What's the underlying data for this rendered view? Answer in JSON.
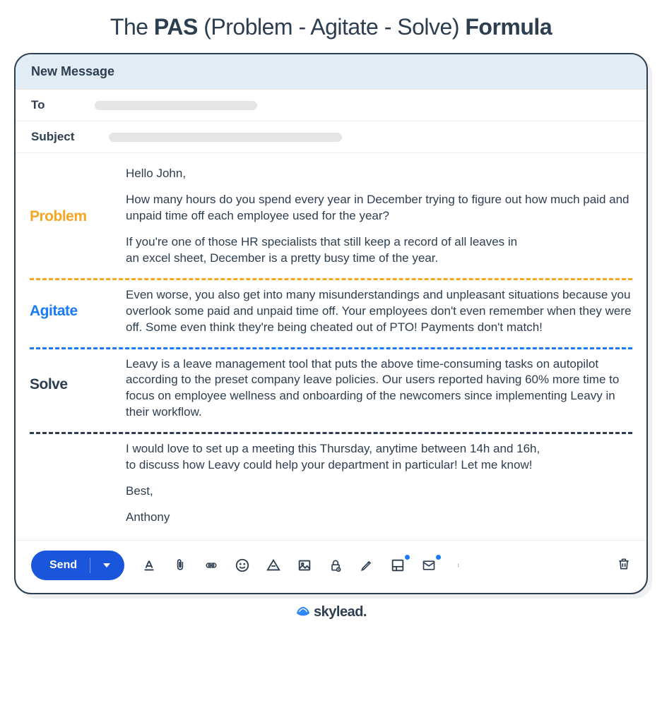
{
  "title": {
    "pre": "The ",
    "pas": "PAS",
    "mid": " (Problem - Agitate - Solve) ",
    "formula": "Formula"
  },
  "compose": {
    "header": "New Message",
    "to_label": "To",
    "subject_label": "Subject",
    "labels": {
      "problem": "Problem",
      "agitate": "Agitate",
      "solve": "Solve"
    },
    "greeting": "Hello John,",
    "problem_p1": "How many hours do you spend every year in December trying to figure out how much paid and unpaid time off each employee used for the year?",
    "problem_p2a": "If you're one of those HR specialists that still keep a record of all leaves in",
    "problem_p2b": "an excel sheet, December is a pretty busy time of the year.",
    "agitate_p": "Even worse, you also get into many misunderstandings and unpleasant situations because you overlook some paid and unpaid time off. Your employees don't even remember when they were off. Some even think they're being cheated out of PTO! Payments don't match!",
    "solve_p": "Leavy is a leave management tool that puts the above time-consuming tasks on autopilot according to the preset company leave policies. Our users reported having 60% more time to focus on employee wellness and onboarding of the newcomers since implementing Leavy in their workflow.",
    "cta_a": "I would love to set up a meeting this Thursday, anytime between 14h and 16h,",
    "cta_b": "to discuss how Leavy could help your department in particular! Let me know!",
    "signoff": "Best,",
    "sender": "Anthony",
    "send_label": "Send"
  },
  "brand": "skylead."
}
